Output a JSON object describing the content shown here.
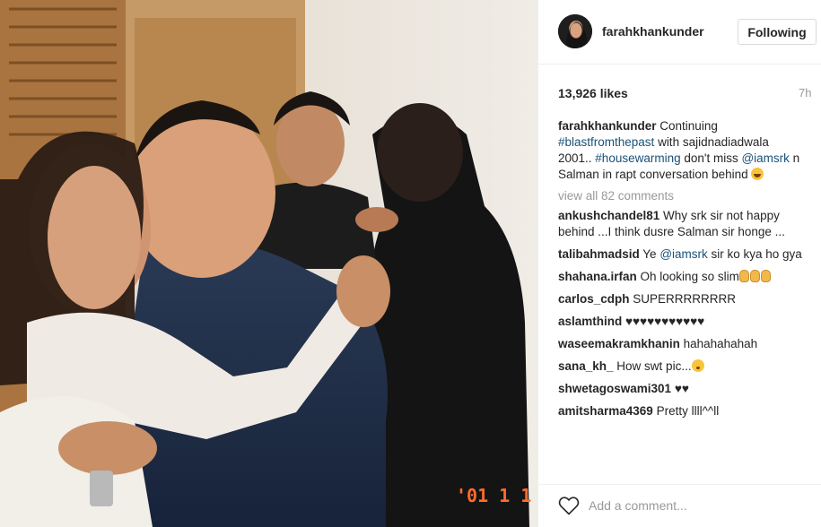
{
  "post": {
    "username": "farahkhankunder",
    "follow_label": "Following",
    "likes": "13,926 likes",
    "time": "7h",
    "photo_date_stamp": "'01 1 1"
  },
  "caption": {
    "user": "farahkhankunder",
    "text_1": " Continuing ",
    "tag_1": "#blastfromthepast",
    "text_2": " with sajidnadiadwala 2001.. ",
    "tag_2": "#housewarming",
    "text_3": " don't miss ",
    "mention_1": "@iamsrk",
    "text_4": " n Salman in rapt conversation behind "
  },
  "view_all": "view all 82 comments",
  "comments": [
    {
      "user": "ankushchandel81",
      "text": " Why srk sir not happy behind ...I think dusre Salman sir honge ..."
    },
    {
      "user": "talibahmadsid",
      "text_pre": " Ye ",
      "mention": "@iamsrk",
      "text_post": " sir ko kya ho gya"
    },
    {
      "user": "shahana.irfan",
      "text": " Oh looking so slim"
    },
    {
      "user": "carlos_cdph",
      "text": " SUPERRRRRRRR"
    },
    {
      "user": "aslamthind",
      "text": " ♥♥♥♥♥♥♥♥♥♥♥"
    },
    {
      "user": "waseemakramkhanin",
      "text": " hahahahahah"
    },
    {
      "user": "sana_kh_",
      "text": " How swt pic..."
    },
    {
      "user": "shwetagoswami301",
      "text": " ♥♥"
    },
    {
      "user": "amitsharma4369",
      "text": " Pretty llll^^ll"
    }
  ],
  "footer": {
    "comment_placeholder": "Add a comment..."
  },
  "colors": {
    "link": "#1a5179",
    "muted": "#999999",
    "border": "#efefef"
  },
  "icons": [
    "heart-icon",
    "avatar",
    "grin-emoji",
    "ok-hand-emoji",
    "flushed-emoji"
  ]
}
